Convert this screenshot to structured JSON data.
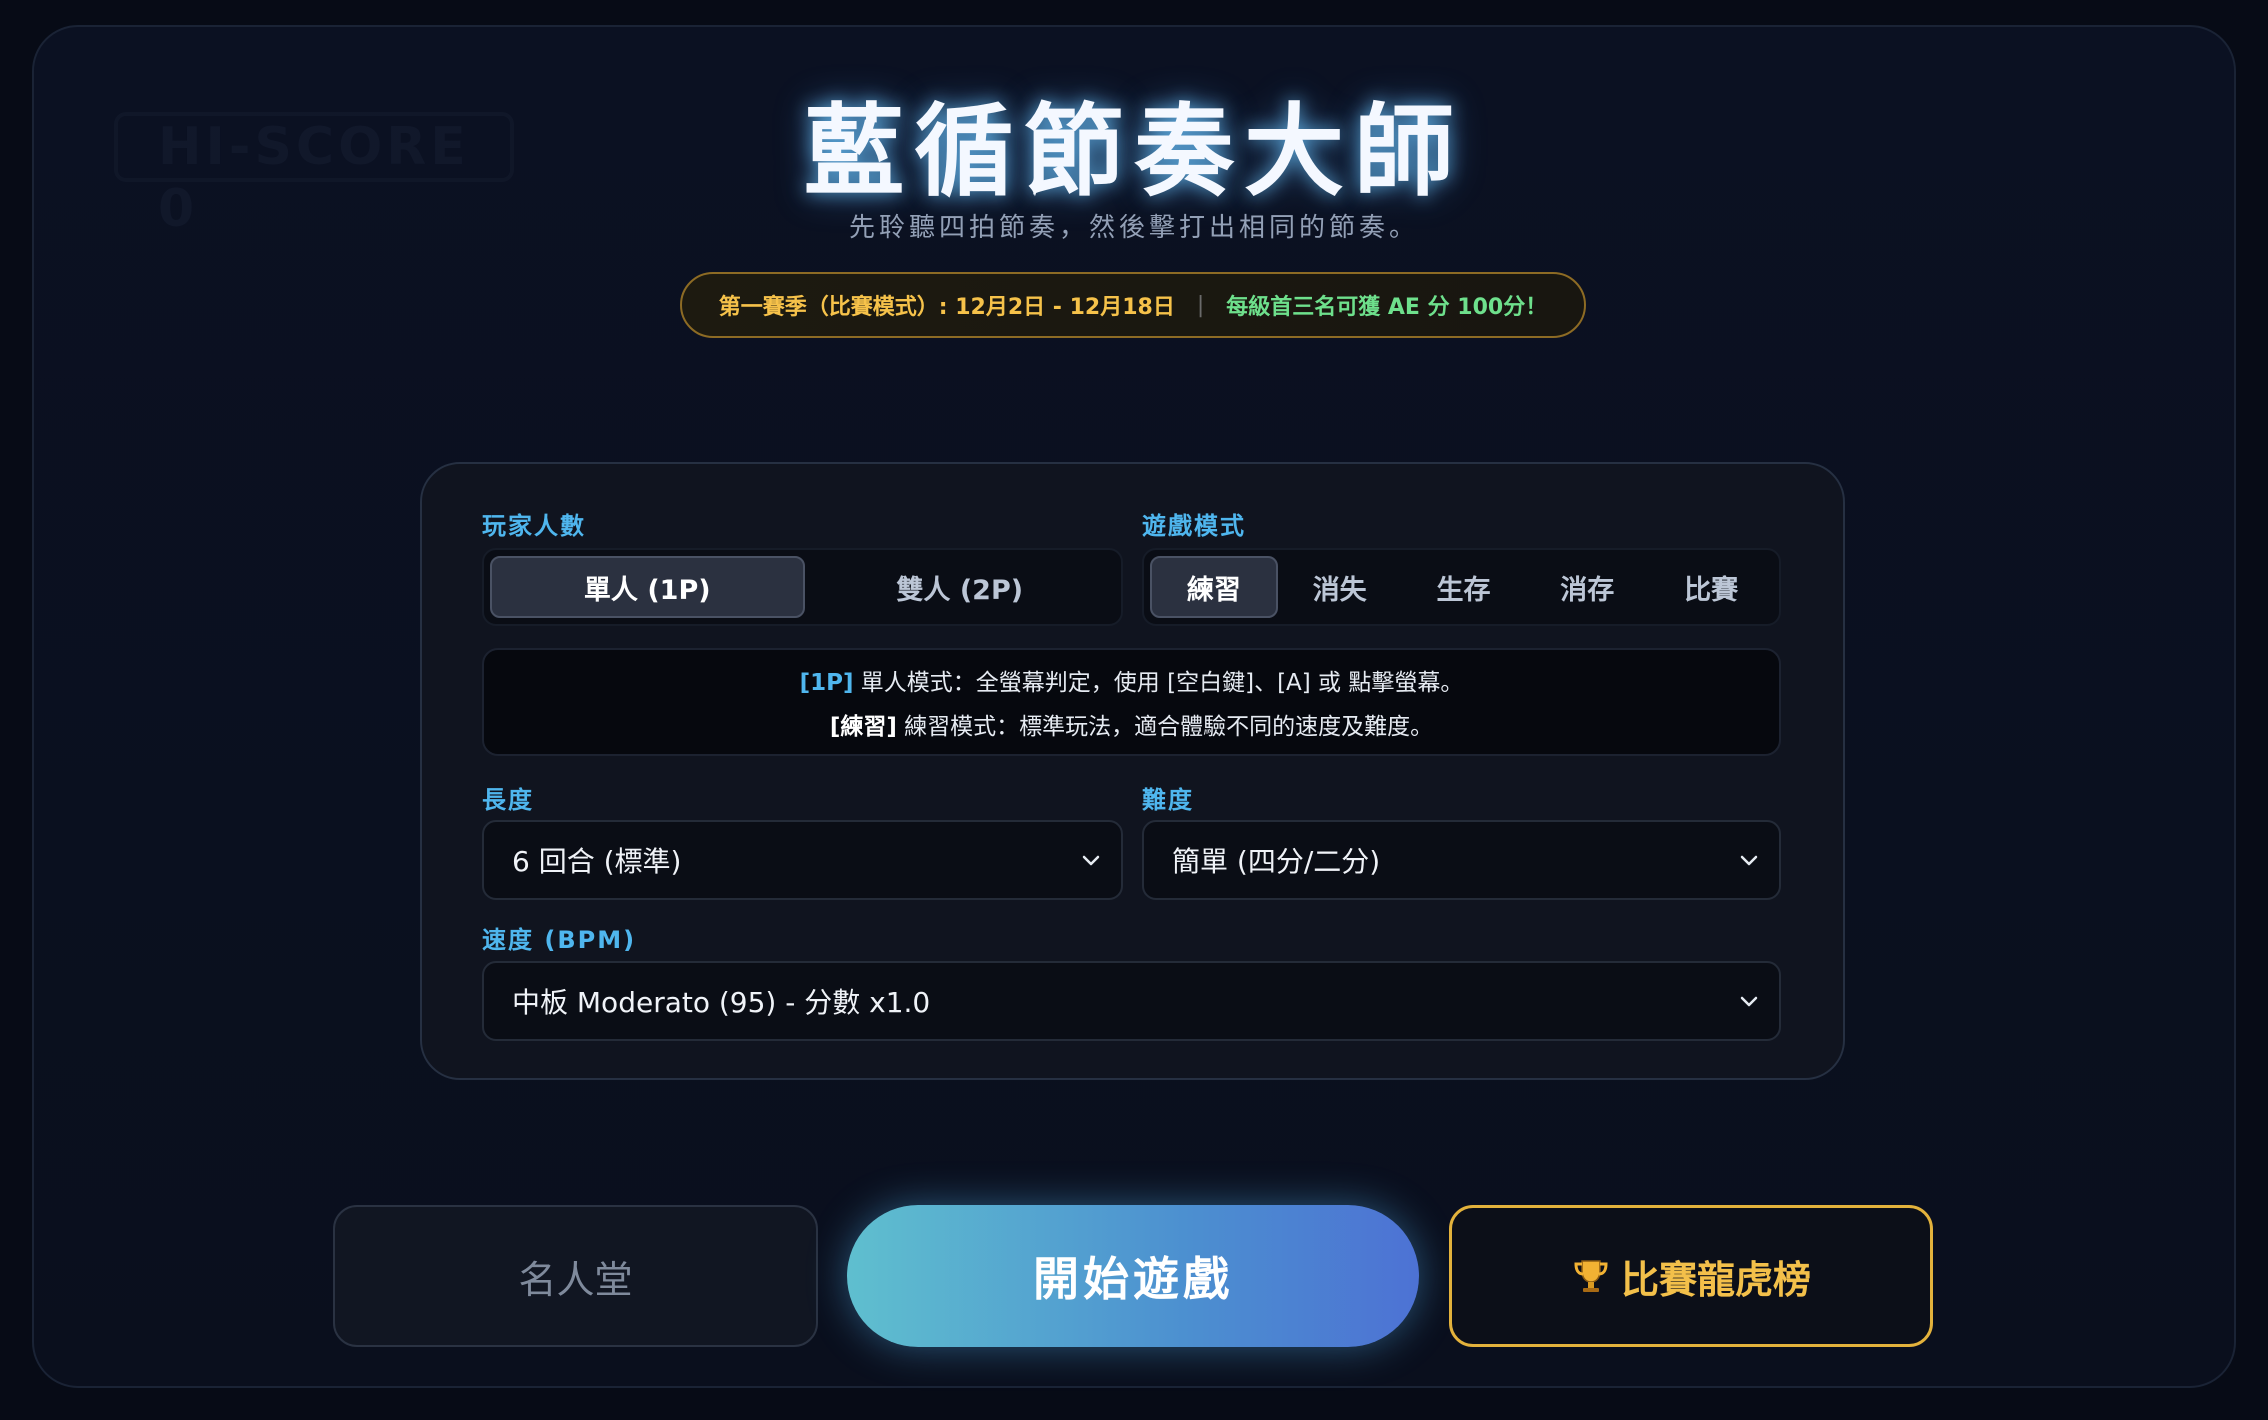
{
  "background_hint": "HI-SCORE 0",
  "title": "藍循節奏大師",
  "subtitle": "先聆聽四拍節奏，然後擊打出相同的節奏。",
  "season": {
    "period": "第一賽季（比賽模式）: 12月2日 - 12月18日",
    "separator": "|",
    "reward": "每級首三名可獲 AE 分 100分！"
  },
  "settings": {
    "players_label": "玩家人數",
    "players": [
      {
        "label": "單人 (1P)",
        "active": true
      },
      {
        "label": "雙人 (2P)",
        "active": false
      }
    ],
    "mode_label": "遊戲模式",
    "modes": [
      {
        "label": "練習",
        "active": true
      },
      {
        "label": "消失",
        "active": false
      },
      {
        "label": "生存",
        "active": false
      },
      {
        "label": "消存",
        "active": false
      },
      {
        "label": "比賽",
        "active": false
      }
    ],
    "info": {
      "line1_tag": "[1P]",
      "line1_text": " 單人模式：全螢幕判定，使用 [空白鍵]、[A] 或 點擊螢幕。",
      "line2_tag": "[練習]",
      "line2_text": " 練習模式：標準玩法，適合體驗不同的速度及難度。"
    },
    "length_label": "長度",
    "length_value": "6 回合 (標準)",
    "difficulty_label": "難度",
    "difficulty_value": "簡單 (四分/二分)",
    "speed_label": "速度 (BPM)",
    "speed_value": "中板 Moderato (95) - 分數 x1.0"
  },
  "buttons": {
    "hall_of_fame": "名人堂",
    "start": "開始遊戲",
    "leaderboard": "比賽龍虎榜",
    "leaderboard_icon": "trophy-icon"
  },
  "colors": {
    "accent_blue": "#4fb6ee",
    "gold": "#f3c04a",
    "green": "#6ee08c"
  }
}
